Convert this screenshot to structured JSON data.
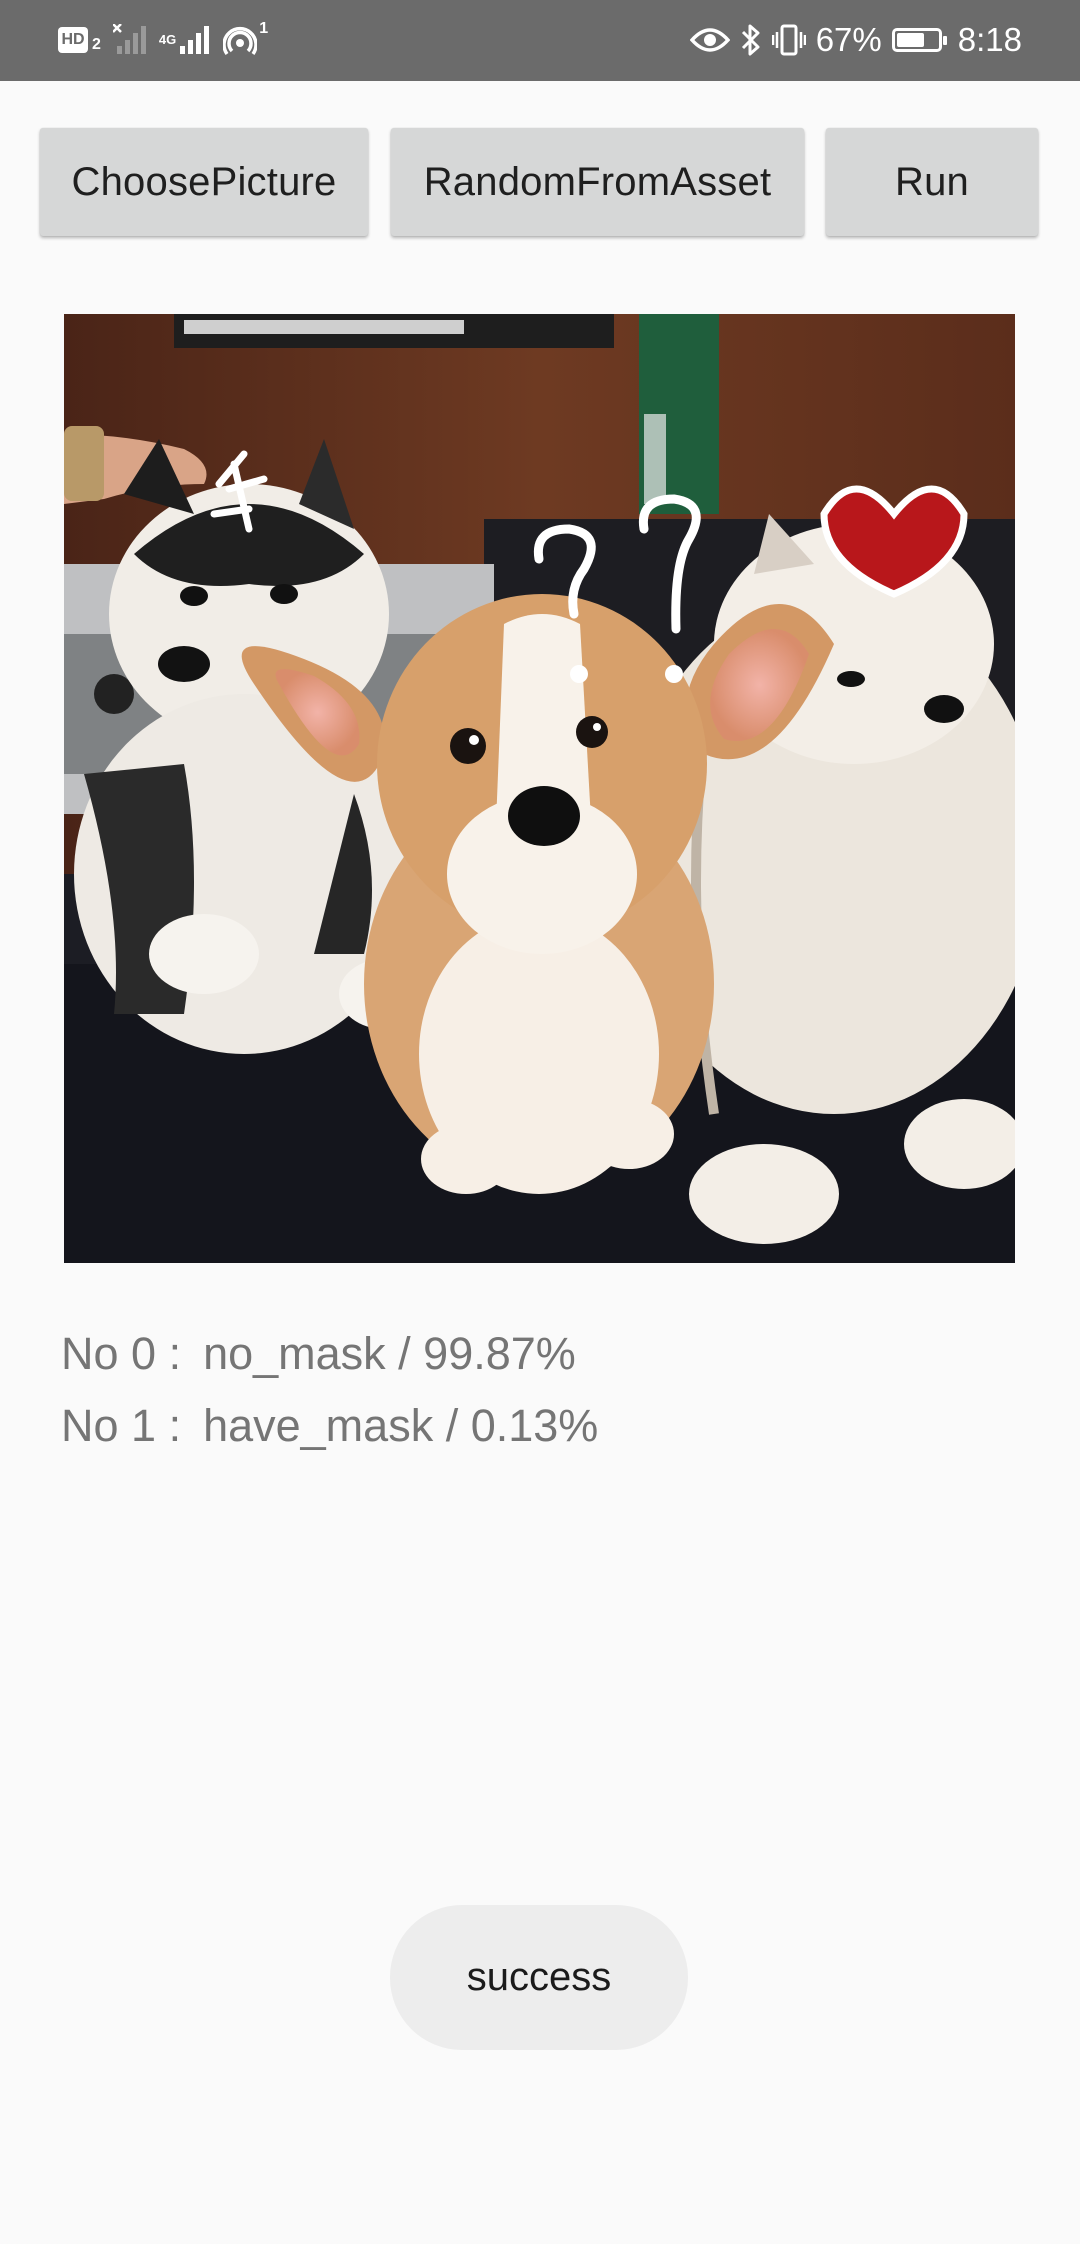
{
  "status_bar": {
    "left_icons": [
      "hd-voice-icon",
      "no-signal-icon",
      "cellular-signal-icon",
      "hotspot-icon"
    ],
    "hd_label": "HD",
    "hd_sub": "2",
    "network_label": "4G",
    "hotspot_count": "1",
    "right_icons": [
      "eye-icon",
      "bluetooth-icon",
      "vibrate-icon",
      "battery-icon"
    ],
    "battery_percent": "67%",
    "battery_level": 0.67,
    "time": "8:18"
  },
  "toolbar": {
    "choose_label": "ChoosePicture",
    "random_label": "RandomFromAsset",
    "run_label": "Run"
  },
  "results": [
    {
      "index_label": "No 0 :",
      "value": "no_mask / 99.87%"
    },
    {
      "index_label": "No 1 :",
      "value": "have_mask / 0.13%"
    }
  ],
  "toast": {
    "message": "success"
  },
  "colors": {
    "status_bar_bg": "#6b6b6b",
    "button_bg": "#d6d7d7",
    "result_text": "#757575",
    "toast_bg": "#ededed",
    "page_bg": "#fafafa"
  }
}
